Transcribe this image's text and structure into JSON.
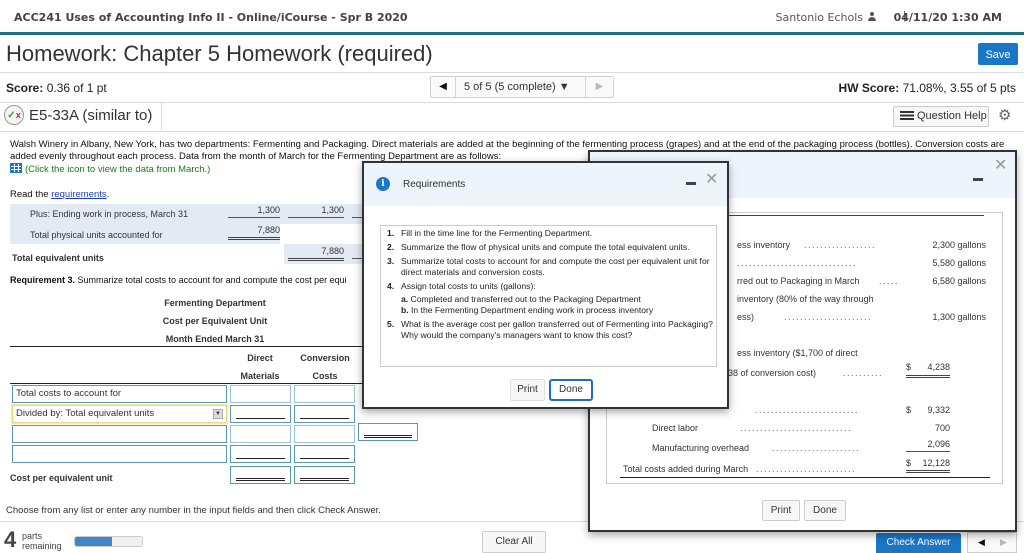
{
  "header": {
    "course": "ACC241 Uses of Accounting Info II - Online/iCourse - Spr B 2020",
    "user_name": "Santonio Echols",
    "separator": "|",
    "datetime": "04/11/20 1:30 AM",
    "brand_color": "#1d6f82"
  },
  "homework": {
    "title": "Homework: Chapter 5 Homework (required)",
    "save_label": "Save",
    "score_label": "Score:",
    "score_value": "0.36 of 1 pt",
    "pager_label": "5 of 5 (5 complete)",
    "pager_caret": "▼",
    "pager_prev": "◀",
    "pager_next": "▶",
    "hw_score_label": "HW Score:",
    "hw_score_value": "71.08%, 3.55 of 5 pts"
  },
  "question": {
    "title": "E5-33A (similar to)",
    "help_label": "Question Help",
    "gear_glyph": "⚙",
    "status_check": "✓",
    "status_x": "x",
    "problem_text": "Walsh Winery in Albany, New York, has two departments: Fermenting and Packaging. Direct materials are added at the beginning of the fermenting process (grapes) and at the end of the packaging process (bottles). Conversion costs are added evenly throughout each process. Data from the month of March for the Fermenting Department are as follows:",
    "data_link": "(Click the icon to view the data from March.)",
    "read_prefix": "Read the",
    "read_link": "requirements",
    "read_suffix": "."
  },
  "units_table": {
    "rows": [
      {
        "label": "Plus: Ending work in process, March 31",
        "physical": "1,300",
        "dm": "1,300"
      },
      {
        "label": "Total physical units accounted for",
        "physical": "7,880"
      }
    ],
    "total_label": "Total equivalent units",
    "total_dm": "7,880"
  },
  "requirement3": {
    "heading_bold": "Requirement 3.",
    "heading_text": " Summarize total costs to account for and compute the cost per equi",
    "title_lines": [
      "Fermenting Department",
      "Cost per Equivalent Unit",
      "Month Ended March 31"
    ],
    "col_headers": [
      {
        "line1": "Direct",
        "line2": "Materials"
      },
      {
        "line1": "Conversion",
        "line2": "Costs"
      }
    ],
    "input_rows": [
      {
        "label": "Total costs to account for",
        "type": "text"
      },
      {
        "label": "Divided by: Total equivalent units",
        "type": "select",
        "caret": "▼"
      },
      {
        "label": "",
        "type": "text"
      },
      {
        "label": "",
        "type": "text"
      }
    ],
    "cpe_label": "Cost per equivalent unit"
  },
  "footer": {
    "instruction": "Choose from any list or enter any number in the input fields and then click Check Answer.",
    "parts_count": "4",
    "parts_line1": "parts",
    "parts_line2": "remaining",
    "progress_fraction": 0.55,
    "clear_all": "Clear All",
    "check_answer": "Check Answer",
    "prev": "◀",
    "next": "▶"
  },
  "data_window": {
    "minimize": "—",
    "close": "✕",
    "rows": [
      {
        "label": "ess inventory",
        "value": "2,300 gallons"
      },
      {
        "label": "",
        "value": "5,580 gallons"
      },
      {
        "label": "rred out to Packaging in March",
        "value": "6,580 gallons"
      },
      {
        "label": "inventory (80% of the way through",
        "value": ""
      },
      {
        "label": "ess)",
        "value": "1,300 gallons"
      }
    ],
    "cost_line1": "ess inventory ($1,700 of direct",
    "cost_line2": "38 of conversion cost)",
    "cost_line2_value": "4,238",
    "colon_fragment": ":",
    "costs": [
      {
        "label": "",
        "value": "9,332",
        "dollar": "$"
      },
      {
        "label": "Direct labor",
        "value": "700",
        "dollar": ""
      },
      {
        "label": "Manufacturing overhead",
        "value": "2,096",
        "dollar": ""
      }
    ],
    "total_label": "Total costs added during March",
    "total_value": "12,128",
    "dollar": "$",
    "print": "Print",
    "done": "Done"
  },
  "requirements_window": {
    "info_glyph": "i",
    "title": "Requirements",
    "minimize": "—",
    "close": "✕",
    "items": [
      {
        "num": "1.",
        "text": "Fill in the time line for the Fermenting Department."
      },
      {
        "num": "2.",
        "text": "Summarize the flow of physical units and compute the total equivalent units."
      },
      {
        "num": "3.",
        "text": "Summarize total costs to account for and compute the cost per equivalent unit for direct materials and conversion costs."
      },
      {
        "num": "4.",
        "text": "Assign total costs to units (gallons):"
      },
      {
        "num": "5.",
        "text": "What is the average cost per gallon transferred out of Fermenting into Packaging? Why would the company's managers want to know this cost?"
      }
    ],
    "sub_items": [
      {
        "letter": "a.",
        "text": " Completed and transferred out to the Packaging Department"
      },
      {
        "letter": "b.",
        "text": " In the Fermenting Department ending work in process inventory"
      }
    ],
    "print": "Print",
    "done": "Done"
  }
}
